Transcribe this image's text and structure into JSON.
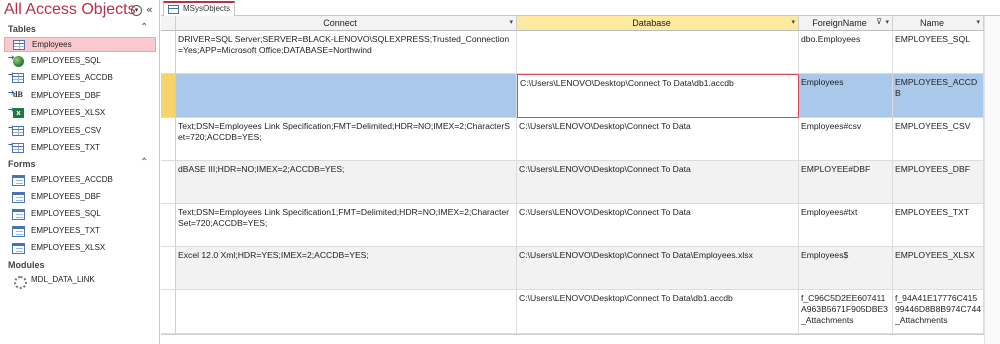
{
  "nav": {
    "title": "All Access Objects",
    "groups": [
      {
        "label": "Tables",
        "items": [
          {
            "label": "Employees",
            "icon": "table-icon",
            "selected": true
          },
          {
            "label": "EMPLOYEES_SQL",
            "icon": "linked-odbc-table-icon"
          },
          {
            "label": "EMPLOYEES_ACCDB",
            "icon": "linked-access-table-icon"
          },
          {
            "label": "EMPLOYEES_DBF",
            "icon": "linked-dbase-table-icon"
          },
          {
            "label": "EMPLOYEES_XLSX",
            "icon": "linked-excel-table-icon"
          },
          {
            "label": "EMPLOYEES_CSV",
            "icon": "linked-text-table-icon"
          },
          {
            "label": "EMPLOYEES_TXT",
            "icon": "linked-text-table-icon"
          }
        ]
      },
      {
        "label": "Forms",
        "items": [
          {
            "label": "EMPLOYEES_ACCDB",
            "icon": "form-icon"
          },
          {
            "label": "EMPLOYEES_DBF",
            "icon": "form-icon"
          },
          {
            "label": "EMPLOYEES_SQL",
            "icon": "form-icon"
          },
          {
            "label": "EMPLOYEES_TXT",
            "icon": "form-icon"
          },
          {
            "label": "EMPLOYEES_XLSX",
            "icon": "form-icon"
          }
        ]
      },
      {
        "label": "Modules",
        "items": [
          {
            "label": "MDL_DATA_LINK",
            "icon": "module-icon"
          }
        ]
      }
    ]
  },
  "doc_tab": {
    "label": "MSysObjects"
  },
  "columns": {
    "connect": "Connect",
    "database": "Database",
    "foreignname": "ForeignName",
    "name": "Name"
  },
  "rows": [
    {
      "connect": "DRIVER=SQL Server;SERVER=BLACK-LENOVO\\SQLEXPRESS;Trusted_Connection=Yes;APP=Microsoft Office;DATABASE=Northwind",
      "database": "",
      "foreignname": "dbo.Employees",
      "name": "EMPLOYEES_SQL"
    },
    {
      "connect": "",
      "database": "C:\\Users\\LENOVO\\Desktop\\Connect To Data\\db1.accdb",
      "foreignname": "Employees",
      "name": "EMPLOYEES_ACCDB"
    },
    {
      "connect": "Text;DSN=Employees Link Specification;FMT=Delimited;HDR=NO;IMEX=2;CharacterSet=720;ACCDB=YES;",
      "database": "C:\\Users\\LENOVO\\Desktop\\Connect To Data",
      "foreignname": "Employees#csv",
      "name": "EMPLOYEES_CSV"
    },
    {
      "connect": "dBASE III;HDR=NO;IMEX=2;ACCDB=YES;",
      "database": "C:\\Users\\LENOVO\\Desktop\\Connect To Data",
      "foreignname": "EMPLOYEE#DBF",
      "name": "EMPLOYEES_DBF"
    },
    {
      "connect": "Text;DSN=Employees Link Specification1;FMT=Delimited;HDR=NO;IMEX=2;CharacterSet=720;ACCDB=YES;",
      "database": "C:\\Users\\LENOVO\\Desktop\\Connect To Data",
      "foreignname": "Employees#txt",
      "name": "EMPLOYEES_TXT"
    },
    {
      "connect": "Excel 12.0 Xml;HDR=YES;IMEX=2;ACCDB=YES;",
      "database": "C:\\Users\\LENOVO\\Desktop\\Connect To Data\\Employees.xlsx",
      "foreignname": "Employees$",
      "name": "EMPLOYEES_XLSX"
    },
    {
      "connect": "",
      "database": "C:\\Users\\LENOVO\\Desktop\\Connect To Data\\db1.accdb",
      "foreignname": "f_C96C5D2EE607411A963B5671F905DBE3_Attachments",
      "name": "f_94A41E17776C41599446D8B8B974C744_Attachments"
    }
  ],
  "colors": {
    "accent": "#b8304a",
    "selected_nav": "#f8c9cf",
    "current_row": "#a9c8ea",
    "header_selected": "#fde9a0"
  }
}
